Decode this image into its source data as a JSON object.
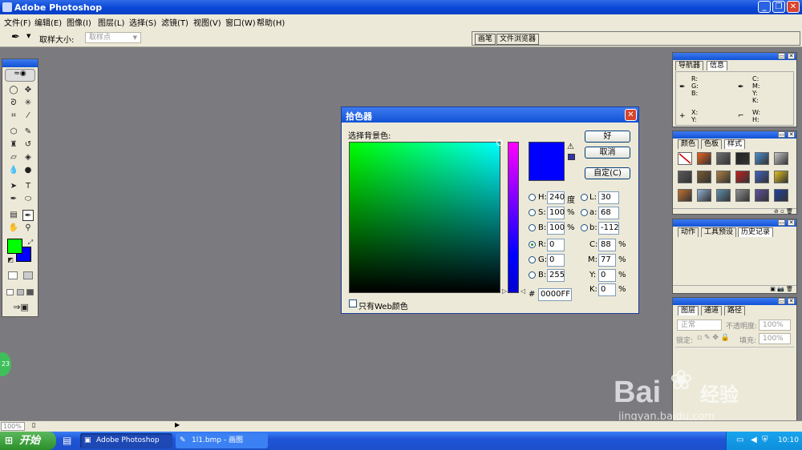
{
  "window": {
    "title": "Adobe Photoshop"
  },
  "menu": [
    "文件(F)",
    "编辑(E)",
    "图像(I)",
    "图层(L)",
    "选择(S)",
    "滤镜(T)",
    "视图(V)",
    "窗口(W)",
    "帮助(H)"
  ],
  "options": {
    "sample_label": "取样大小:",
    "sample_value": "取样点",
    "palette_tabs": [
      "画笔",
      "文件浏览器"
    ]
  },
  "toolbox": {
    "foreground": "#00ff00",
    "background": "#0000ff"
  },
  "picker": {
    "title": "拾色器",
    "prompt": "选择背景色:",
    "ok": "好",
    "cancel": "取消",
    "custom": "自定(C)",
    "new_color": "#0000ff",
    "fields": {
      "H": "240",
      "H_unit": "度",
      "S": "100",
      "S_unit": "%",
      "B": "100",
      "B_unit": "%",
      "R": "0",
      "G": "0",
      "Bl": "255",
      "L": "30",
      "a": "68",
      "b": "-112",
      "C": "88",
      "M": "77",
      "Y": "0",
      "K": "0",
      "pct": "%",
      "hex": "0000FF",
      "hash": "#"
    },
    "labels": {
      "H": "H:",
      "S": "S:",
      "B": "B:",
      "R": "R:",
      "G": "G:",
      "Bl": "B:",
      "L": "L:",
      "a": "a:",
      "b": "b:",
      "C": "C:",
      "M": "M:",
      "Y": "Y:",
      "K": "K:"
    },
    "web_only": "只有Web颜色"
  },
  "panels": {
    "nav": {
      "tabs": [
        "导航器",
        "信息"
      ],
      "labels": {
        "rgb": "R:\nG:\nB:",
        "cmyk": "C:\nM:\nY:\nK:",
        "xy": "X:\nY:",
        "wh": "W:\nH:"
      }
    },
    "color": {
      "tabs": [
        "颜色",
        "色板",
        "样式"
      ]
    },
    "history": {
      "tabs": [
        "动作",
        "工具预设",
        "历史记录"
      ]
    },
    "layers": {
      "tabs": [
        "图层",
        "通道",
        "路径"
      ],
      "blend": "正常",
      "opacity_label": "不透明度:",
      "opacity": "100%",
      "lock_label": "锁定:",
      "fill_label": "填充:",
      "fill": "100%"
    }
  },
  "status": {
    "zoom": "100%"
  },
  "taskbar": {
    "start": "开始",
    "tasks": [
      "Adobe Photoshop",
      "1l1.bmp - 画图"
    ],
    "time": "10:10"
  },
  "watermark": {
    "text1": "Bai",
    "text2": "经验",
    "url": "jingyan.baidu.com"
  },
  "badge": "23"
}
